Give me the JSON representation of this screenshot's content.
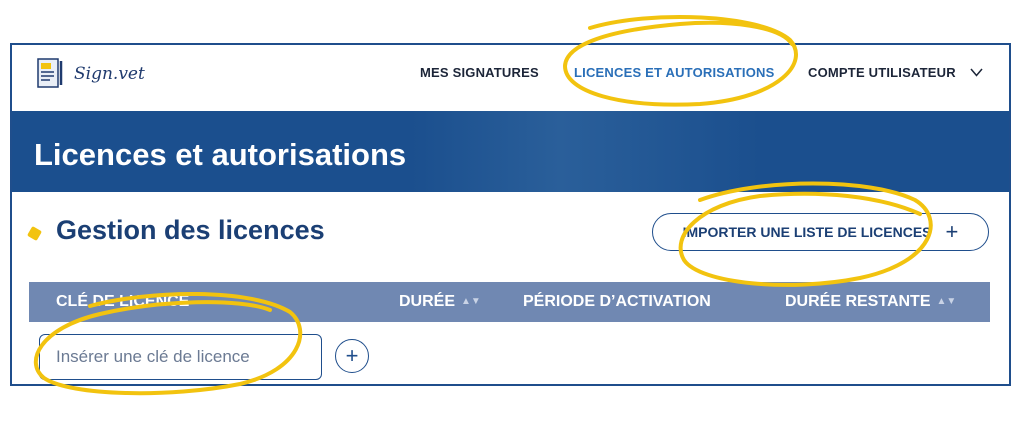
{
  "header": {
    "logo_text": "Sign.vet",
    "nav": [
      {
        "label": "MES SIGNATURES"
      },
      {
        "label": "LICENCES ET AUTORISATIONS",
        "active": true
      },
      {
        "label": "COMPTE UTILISATEUR"
      }
    ]
  },
  "banner": {
    "title": "Licences et autorisations"
  },
  "section": {
    "title": "Gestion des licences",
    "import_label": "IMPORTER UNE LISTE DE LICENCES"
  },
  "table": {
    "columns": [
      "CLÉ DE LICENCE",
      "DURÉE",
      "PÉRIODE D’ACTIVATION",
      "DURÉE RESTANTE"
    ]
  },
  "input": {
    "placeholder": "Insérer une clé de licence"
  },
  "icons": {
    "chevron": "chevron-down-icon",
    "plus": "plus-icon",
    "sort": "sort-icon"
  },
  "colors": {
    "brand_blue": "#1b4f8e",
    "active_link": "#2a6fb8",
    "table_header": "#7088b2",
    "highlight": "#f2c30f"
  }
}
